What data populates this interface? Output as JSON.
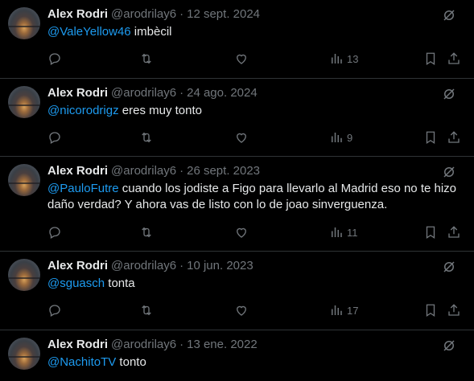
{
  "colors": {
    "background": "#000000",
    "text": "#e7e9ea",
    "muted": "#71767b",
    "mention": "#1d9bf0",
    "divider": "#2f3336"
  },
  "icons": {
    "reply": "reply-icon",
    "retweet": "retweet-icon",
    "like": "like-icon",
    "views": "views-icon",
    "bookmark": "bookmark-icon",
    "share": "share-icon",
    "grok": "grok-icon"
  },
  "tweets": [
    {
      "name": "Alex Rodri",
      "handle": "@arodrilay6",
      "separator": "·",
      "date": "12 sept. 2024",
      "mention": "@ValeYellow46",
      "text": " imbècil",
      "views": "13"
    },
    {
      "name": "Alex Rodri",
      "handle": "@arodrilay6",
      "separator": "·",
      "date": "24 ago. 2024",
      "mention": "@nicorodrigz",
      "text": " eres muy tonto",
      "views": "9"
    },
    {
      "name": "Alex Rodri",
      "handle": "@arodrilay6",
      "separator": "·",
      "date": "26 sept. 2023",
      "mention": "@PauloFutre",
      "text": " cuando los jodiste a Figo para llevarlo al Madrid eso no te hizo daño verdad? Y ahora vas de listo con lo de joao sinverguenza.",
      "views": "11"
    },
    {
      "name": "Alex Rodri",
      "handle": "@arodrilay6",
      "separator": "·",
      "date": "10 jun. 2023",
      "mention": "@sguasch",
      "text": " tonta",
      "views": "17"
    },
    {
      "name": "Alex Rodri",
      "handle": "@arodrilay6",
      "separator": "·",
      "date": "13 ene. 2022",
      "mention": "@NachitoTV",
      "text": " tonto",
      "views": ""
    }
  ]
}
